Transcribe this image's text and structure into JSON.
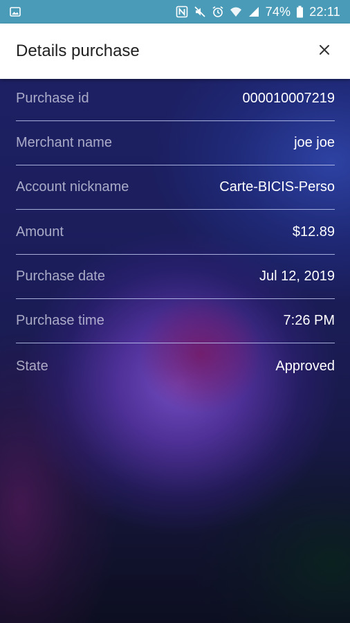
{
  "status_bar": {
    "battery_percent": "74%",
    "time": "22:11",
    "icons": [
      "gallery-icon",
      "nfc-icon",
      "mute-icon",
      "alarm-icon",
      "wifi-icon",
      "signal-icon",
      "battery-icon"
    ]
  },
  "app_bar": {
    "title": "Details purchase",
    "close_icon": "close-icon"
  },
  "details": [
    {
      "label": "Purchase id",
      "value": "000010007219"
    },
    {
      "label": "Merchant name",
      "value": "joe joe"
    },
    {
      "label": "Account nickname",
      "value": "Carte-BICIS-Perso"
    },
    {
      "label": "Amount",
      "value": "$12.89"
    },
    {
      "label": "Purchase date",
      "value": "Jul 12, 2019"
    },
    {
      "label": "Purchase time",
      "value": "7:26 PM"
    },
    {
      "label": "State",
      "value": "Approved"
    }
  ],
  "colors": {
    "status_bar": "#4a9bb8",
    "app_bar": "#ffffff",
    "title_text": "#212121",
    "value_text": "#ffffff",
    "divider": "#bec8f0"
  }
}
